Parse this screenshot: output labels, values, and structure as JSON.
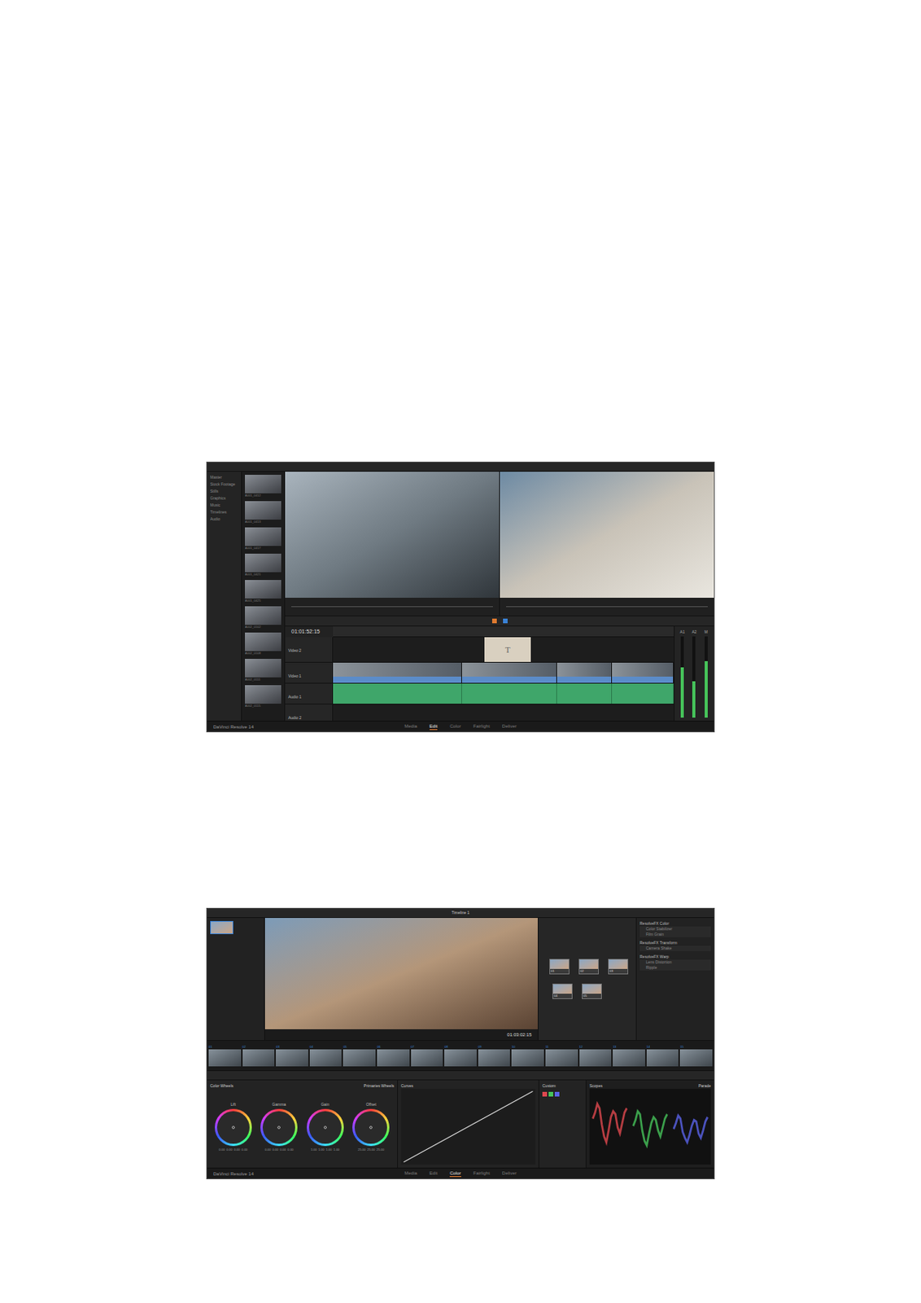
{
  "edit_screenshot": {
    "app_name": "DaVinci Resolve 14",
    "timecode": "01:01:52:15",
    "bins": [
      "Master",
      "Stock Footage",
      "Stills",
      "Graphics",
      "Music",
      "Timelines",
      "Audio"
    ],
    "clip_thumbnails": [
      {
        "label": "A001_0412"
      },
      {
        "label": "A001_0413"
      },
      {
        "label": "A001_0417"
      },
      {
        "label": "A001_0421"
      },
      {
        "label": "A001_0425"
      },
      {
        "label": "A002_0102"
      },
      {
        "label": "A002_0108"
      },
      {
        "label": "A002_0111"
      },
      {
        "label": "A002_0115"
      }
    ],
    "tracks": [
      {
        "name": "Video 2",
        "kind": "title"
      },
      {
        "name": "Video 1",
        "kind": "video"
      },
      {
        "name": "Audio 1",
        "kind": "audio"
      },
      {
        "name": "Audio 2",
        "kind": "empty"
      }
    ],
    "title_clip": "T",
    "video_clips": [
      {
        "share": 0.38
      },
      {
        "share": 0.28
      },
      {
        "share": 0.16
      },
      {
        "share": 0.18
      }
    ],
    "mixer_channels": [
      {
        "name": "A1",
        "level": 0.62
      },
      {
        "name": "A2",
        "level": 0.45
      },
      {
        "name": "M",
        "level": 0.7
      }
    ],
    "page_tabs": [
      {
        "label": "Media",
        "selected": false
      },
      {
        "label": "Edit",
        "selected": true
      },
      {
        "label": "Color",
        "selected": false
      },
      {
        "label": "Fairlight",
        "selected": false
      },
      {
        "label": "Deliver",
        "selected": false
      }
    ]
  },
  "color_screenshot": {
    "app_name": "DaVinci Resolve 14",
    "timeline_name": "Timeline 1",
    "timecode": "01:03:02:15",
    "nodes": [
      {
        "label": "01",
        "row": "top"
      },
      {
        "label": "02",
        "row": "top"
      },
      {
        "label": "03",
        "row": "top"
      },
      {
        "label": "04",
        "row": "bottom"
      },
      {
        "label": "05",
        "row": "bottom"
      }
    ],
    "library_sections": [
      {
        "title": "ResolveFX Color",
        "items": [
          "Color Stabilizer",
          "Film Grain"
        ]
      },
      {
        "title": "ResolveFX Transform",
        "items": [
          "Camera Shake"
        ]
      },
      {
        "title": "ResolveFX Warp",
        "items": [
          "Lens Distortion",
          "Ripple"
        ]
      }
    ],
    "strip_clips": [
      "01",
      "02",
      "03",
      "04",
      "05",
      "06",
      "07",
      "08",
      "09",
      "10",
      "11",
      "12",
      "13",
      "14",
      "15"
    ],
    "wheels_title": "Color Wheels",
    "wheels_mode": "Primaries Wheels",
    "wheels": [
      {
        "name": "Lift",
        "values": [
          "0.00",
          "0.00",
          "0.00",
          "0.00"
        ]
      },
      {
        "name": "Gamma",
        "values": [
          "0.00",
          "0.00",
          "0.00",
          "0.00"
        ]
      },
      {
        "name": "Gain",
        "values": [
          "1.00",
          "1.00",
          "1.00",
          "1.00"
        ]
      },
      {
        "name": "Offset",
        "values": [
          "25.00",
          "25.00",
          "25.00"
        ]
      }
    ],
    "curves_title": "Curves",
    "custom_title": "Custom",
    "scopes_title": "Scopes",
    "scopes_mode": "Parade",
    "parade": [
      {
        "channel": "R",
        "color": "#e0484f",
        "values": [
          620,
          700,
          820,
          760,
          540,
          380,
          300,
          460,
          640,
          720,
          680,
          500,
          420,
          560,
          700,
          760
        ]
      },
      {
        "channel": "G",
        "color": "#46c35a",
        "values": [
          520,
          600,
          720,
          680,
          460,
          320,
          260,
          420,
          560,
          640,
          600,
          460,
          380,
          500,
          620,
          680
        ]
      },
      {
        "channel": "B",
        "color": "#5a63e8",
        "values": [
          480,
          560,
          660,
          620,
          440,
          360,
          300,
          400,
          520,
          600,
          580,
          420,
          360,
          460,
          580,
          640
        ]
      }
    ],
    "page_tabs": [
      {
        "label": "Media",
        "selected": false
      },
      {
        "label": "Edit",
        "selected": false
      },
      {
        "label": "Color",
        "selected": true
      },
      {
        "label": "Fairlight",
        "selected": false
      },
      {
        "label": "Deliver",
        "selected": false
      }
    ]
  }
}
